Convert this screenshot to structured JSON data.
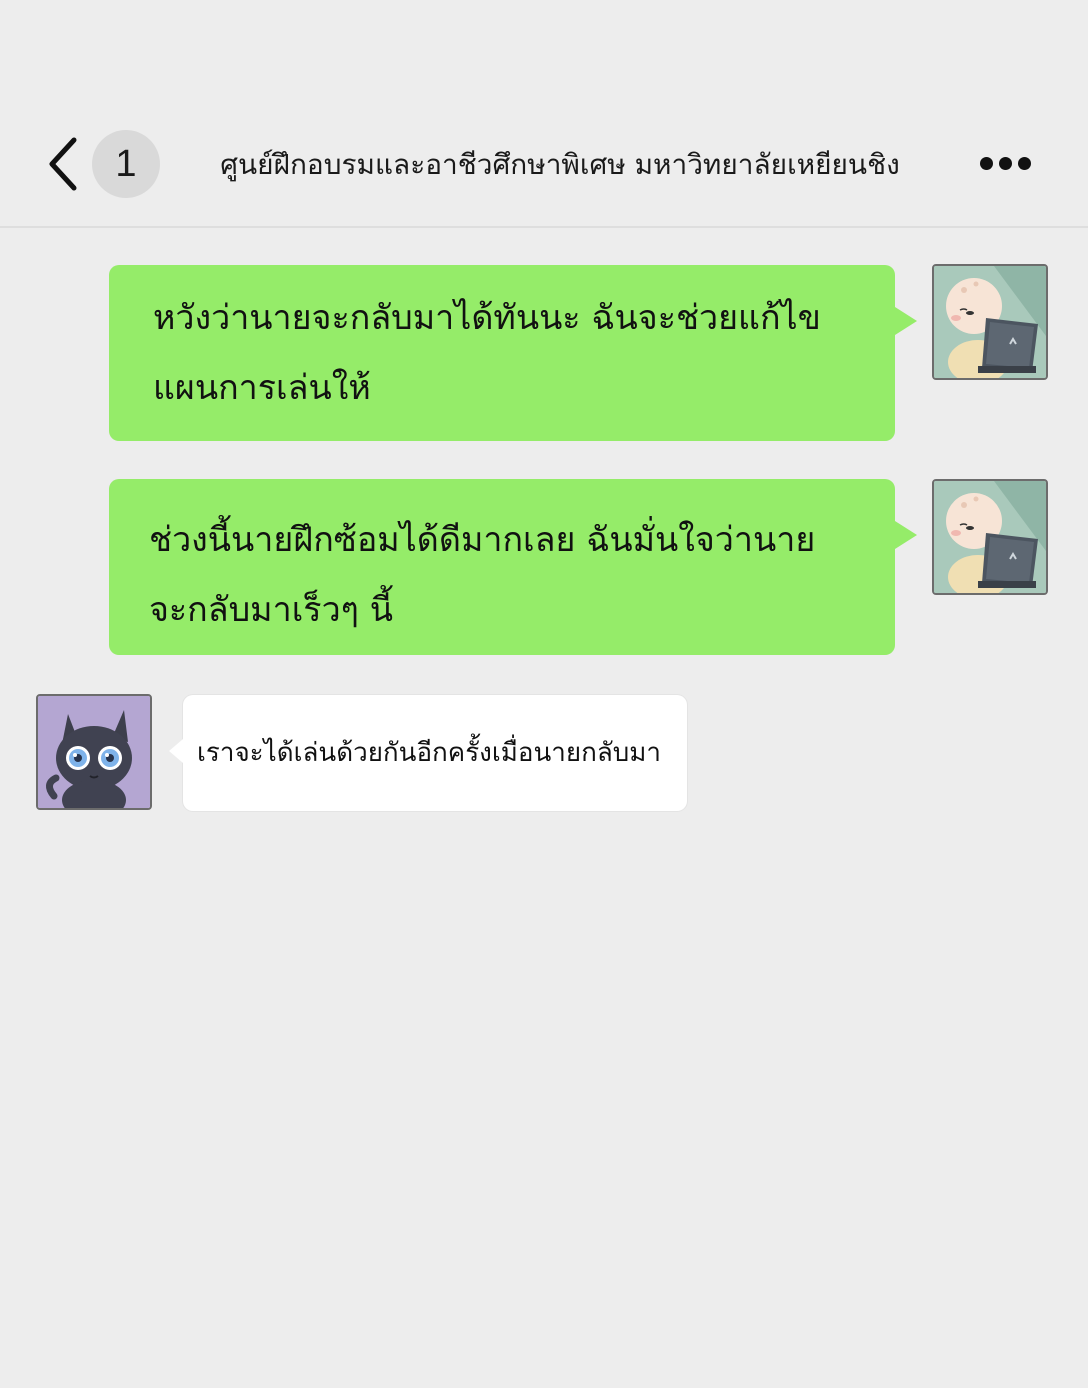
{
  "header": {
    "back_icon": "chevron-left-icon",
    "unread_count": "1",
    "title": "ศูนย์ฝึกอบรมและอาชีวศึกษาพิเศษ มหาวิทยาลัยเหยียนชิง",
    "more_icon": "more-horizontal-icon"
  },
  "messages": [
    {
      "sender": "self",
      "avatar": "bald-baby-laptop-avatar",
      "text": "หวังว่านายจะกลับมาได้ทันนะ ฉันจะช่วยแก้ไข\nแผนการเล่นให้"
    },
    {
      "sender": "self",
      "avatar": "bald-baby-laptop-avatar",
      "text": "ช่วงนี้นายฝึกซ้อมได้ดีมากเลย ฉันมั่นใจว่านาย\nจะกลับมาเร็วๆ นี้"
    },
    {
      "sender": "other",
      "avatar": "black-cat-avatar",
      "text": "เราจะได้เล่นด้วยกันอีกครั้งเมื่อนายกลับมา"
    }
  ],
  "colors": {
    "background": "#ededed",
    "sent_bubble": "#95ec69",
    "received_bubble": "#ffffff",
    "badge": "#d9d9d9"
  }
}
